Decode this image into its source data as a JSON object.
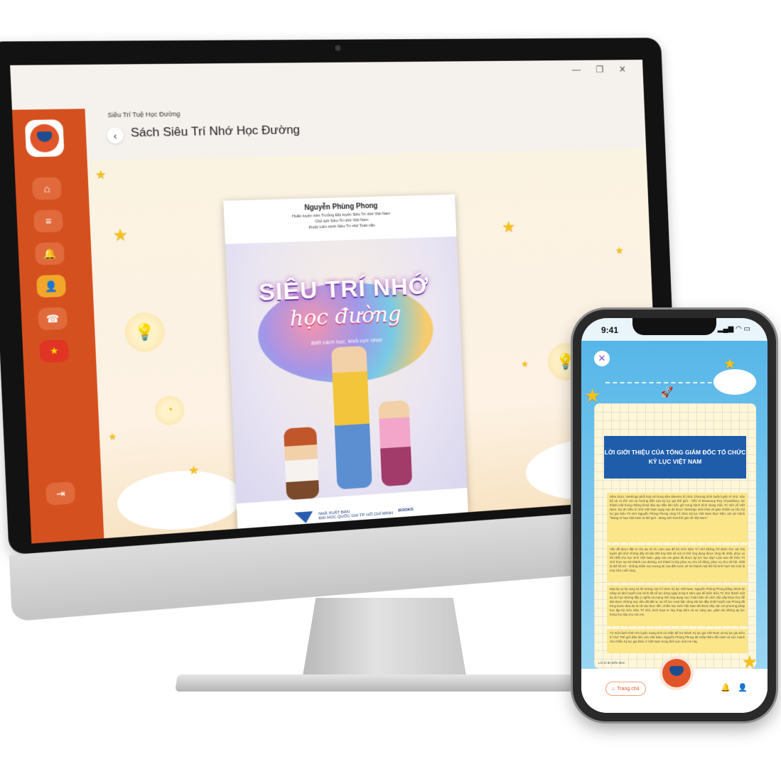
{
  "desktop": {
    "window_controls": "—  ❐  ✕",
    "breadcrumb": "Siêu Trí Tuệ Học Đường",
    "page_title": "Sách Siêu Trí Nhớ Học Đường",
    "back_glyph": "‹",
    "nav_items": [
      {
        "glyph": "⌂",
        "name": "home"
      },
      {
        "glyph": "≡",
        "name": "list"
      },
      {
        "glyph": "🔔",
        "name": "notifications"
      },
      {
        "glyph": "👤",
        "name": "profile"
      },
      {
        "glyph": "☎",
        "name": "support"
      },
      {
        "glyph": "★",
        "name": "language-vietnam"
      }
    ],
    "logout_glyph": "⇥",
    "book_cover": {
      "author": "Nguyễn Phùng Phong",
      "credentials": [
        "Huấn luyện viên Trưởng Đội tuyển Siêu Trí nhớ Việt Nam",
        "Chủ tịch Siêu Trí nhớ Việt Nam",
        "thuộc Liên minh Siêu Trí nhớ Toàn cầu"
      ],
      "title": "SIÊU TRÍ NHỚ",
      "script_title": "học đường",
      "tagline": "Biết cách học, khỏi cực nhọc",
      "publisher_name": "NHÀ XUẤT BẢN",
      "publisher_full": "ĐẠI HỌC QUỐC GIA TP. HỒ CHÍ MINH",
      "spine_label": "BOOKS"
    }
  },
  "phone": {
    "time": "9:41",
    "status_icons": "▂▄▆ ◠ ▭",
    "close_glyph": "✕",
    "intro_title": "LỜI GIỚI THIỆU CỦA TỔNG GIÁM ĐỐC TỔ CHỨC KỶ LỤC VIỆT NAM",
    "paragraphs": [
      "Năm 2014, VietKings phối hợp với trung tâm 8ireems tổ chức Chương trình huấn luyện trí nhớ, não bộ và có thể với sự hướng dẫn của Kỷ lục gia thế giới - Tiến sĩ Bewaroop Roy Chowdhury, trở thành một trong những khoá đào tạo đầu tiên bốc giờ trong hành trình mang Siêu Trí nhớ về Việt Nam. Dự án Siêu trí nhớ Việt Nam ngay sau đó được VietKings triển khai và giao nhiệm vụ cho Kỷ lục gia Siêu Trí nhớ Nguyễn Phùng Phong cùng Tổ chức Kỷ lục Việt Nam thực hiện, với sứ mệnh \"Mang trí hoa Việt Nam ra thế giới - Mang tinh hoa thế giới về Việt Nam\".",
      "Vấn đề được đặt ra cho dự án là: Làm sao để bộ môn Siêu Trí nhớ không chỉ dành cho các thủ luyện ghi nhớ những dãy số dài 300 hay 500 số mà có thể ứng dụng được rộng rãi nhất, phục vụ tốt nhất cho học sinh Việt Nam, giúp các em giảm tải được áp lực học tập? Làm sao để Siêu Trí nhớ thực sự trở thành con đường, trở thành bí kíp phục vụ cho số đông, phục vụ cho xã hội, nhất là thế hệ trẻ - những mầm non tương lai của đất nước sẽ trở thành một thế hệ tinh hoa? Đó mới là mục tiêu cuối cùng.",
      "Đáp lại sự kỳ vọng và lời tưởng của Tổ chức Kỷ lục Việt Nam, Nguyễn Phùng Phong bằng chính tài năng và tâm huyết của mình đã nỗ lực từng ngày trong 6 năm qua để biến Siêu Trí nhớ thành một dụ án học đường đầy ý nghĩa và mang tính ứng dụng cao: hoàn bảo về cách xếp sắp khoa học để đạt được những mục tiêu đã đặt ra; sự nỗ lực vượt bậc cũng trải tim đầy nhiệt huyết của Phong đã từng bước đưa dự án đi vào thực tiễn, nhiều học sinh Việt Nam đã được tiếp cận với phương pháp học tập bộ môn Siêu Trí nhớ, kích hoạt tư duy thay tiêm và sự sáng tạo, giảm tải những áp lực trong học tập cho các em.",
      "Từ một hành trình rèn luyện mang tính cá nhân để trở thành Kỷ lục gia Việt Nam và Kỷ lục gia Siêu trí nhớ Thế giới đầu tiên của Việt Nam, Nguyễn Phùng Phong đã chắp thêm đôi cánh và sức mạnh cho nhiều Kỷ lục gia khác ở Việt Nam trong thời vực mới mẻ này."
    ],
    "footnote": "Lời tri ân kiến thức",
    "nav": {
      "home_label": "Trang chủ",
      "home_glyph": "⌂",
      "bell_glyph": "🔔",
      "user_glyph": "👤"
    }
  },
  "colors": {
    "sidebar": "#d5501f",
    "accent_yellow": "#f2a72b",
    "phone_banner": "#1f5dab",
    "phone_sky": "#56b6e8"
  }
}
